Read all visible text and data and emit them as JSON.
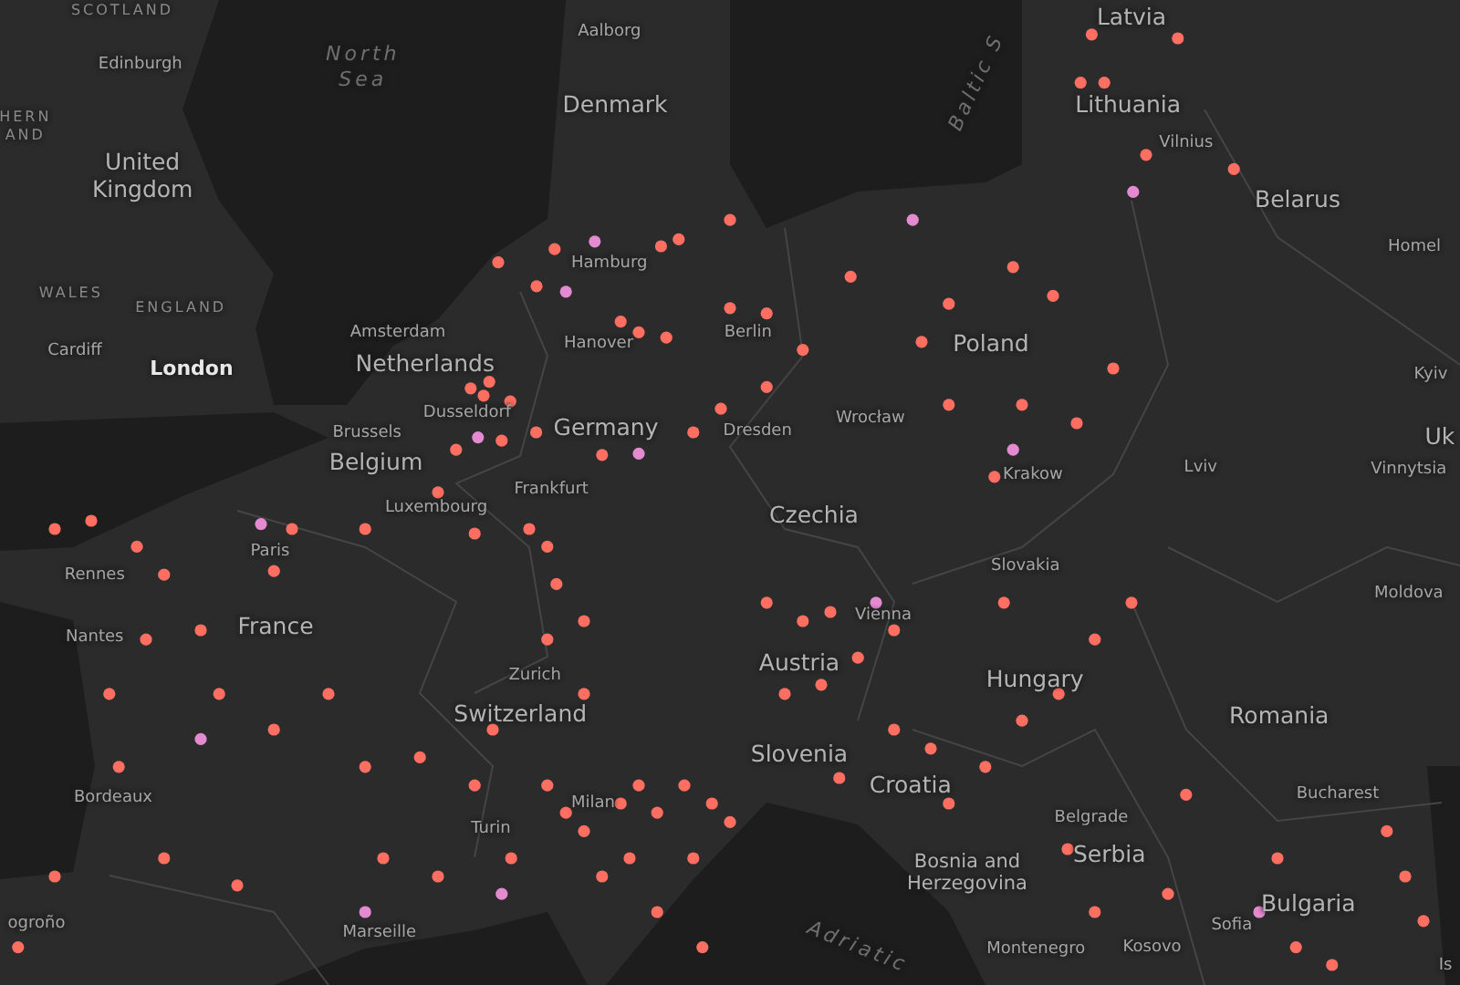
{
  "map": {
    "labels": [
      {
        "text": "SCOTLAND",
        "kind": "region"
      },
      {
        "text": "HERN AND",
        "kind": "region"
      },
      {
        "text": "Edinburgh",
        "kind": "city"
      },
      {
        "text": "United Kingdom",
        "kind": "country"
      },
      {
        "text": "WALES",
        "kind": "region"
      },
      {
        "text": "ENGLAND",
        "kind": "region"
      },
      {
        "text": "Cardiff",
        "kind": "city"
      },
      {
        "text": "London",
        "kind": "capital"
      },
      {
        "text": "North Sea",
        "kind": "sea"
      },
      {
        "text": "Aalborg",
        "kind": "city"
      },
      {
        "text": "Denmark",
        "kind": "country"
      },
      {
        "text": "Baltic S",
        "kind": "sea_up"
      },
      {
        "text": "Latvia",
        "kind": "country"
      },
      {
        "text": "Lithuania",
        "kind": "country"
      },
      {
        "text": "Vilnius",
        "kind": "city"
      },
      {
        "text": "Belarus",
        "kind": "country"
      },
      {
        "text": "Homel",
        "kind": "city"
      },
      {
        "text": "Hamburg",
        "kind": "city"
      },
      {
        "text": "Amsterdam",
        "kind": "city"
      },
      {
        "text": "Netherlands",
        "kind": "country"
      },
      {
        "text": "Hanover",
        "kind": "city"
      },
      {
        "text": "Berlin",
        "kind": "city"
      },
      {
        "text": "Poland",
        "kind": "country"
      },
      {
        "text": "Kyiv",
        "kind": "city"
      },
      {
        "text": "Brussels",
        "kind": "city"
      },
      {
        "text": "Dusseldorf",
        "kind": "city"
      },
      {
        "text": "Germany",
        "kind": "country"
      },
      {
        "text": "Dresden",
        "kind": "city"
      },
      {
        "text": "Wrocław",
        "kind": "city"
      },
      {
        "text": "Uk",
        "kind": "country"
      },
      {
        "text": "Belgium",
        "kind": "country"
      },
      {
        "text": "Krakow",
        "kind": "city"
      },
      {
        "text": "Lviv",
        "kind": "city"
      },
      {
        "text": "Vinnytsia",
        "kind": "city"
      },
      {
        "text": "Luxembourg",
        "kind": "city"
      },
      {
        "text": "Frankfurt",
        "kind": "city"
      },
      {
        "text": "Czechia",
        "kind": "country"
      },
      {
        "text": "Paris",
        "kind": "city"
      },
      {
        "text": "Rennes",
        "kind": "city"
      },
      {
        "text": "Slovakia",
        "kind": "city"
      },
      {
        "text": "Moldova",
        "kind": "city"
      },
      {
        "text": "Vienna",
        "kind": "city"
      },
      {
        "text": "Nantes",
        "kind": "city"
      },
      {
        "text": "France",
        "kind": "country"
      },
      {
        "text": "Austria",
        "kind": "country"
      },
      {
        "text": "Zurich",
        "kind": "city"
      },
      {
        "text": "Hungary",
        "kind": "country"
      },
      {
        "text": "Switzerland",
        "kind": "country"
      },
      {
        "text": "Romania",
        "kind": "country"
      },
      {
        "text": "Slovenia",
        "kind": "country"
      },
      {
        "text": "Croatia",
        "kind": "country"
      },
      {
        "text": "Bordeaux",
        "kind": "city"
      },
      {
        "text": "Bucharest",
        "kind": "city"
      },
      {
        "text": "Milan",
        "kind": "city"
      },
      {
        "text": "Belgrade",
        "kind": "city"
      },
      {
        "text": "Turin",
        "kind": "city"
      },
      {
        "text": "Serbia",
        "kind": "country"
      },
      {
        "text": "Bosnia and Herzegovina",
        "kind": "country_small"
      },
      {
        "text": "Bulgaria",
        "kind": "country"
      },
      {
        "text": "Sofia",
        "kind": "city"
      },
      {
        "text": "Marseille",
        "kind": "city"
      },
      {
        "text": "ogroño",
        "kind": "city"
      },
      {
        "text": "Montenegro",
        "kind": "city"
      },
      {
        "text": "Kosovo",
        "kind": "city"
      },
      {
        "text": "Adriatic",
        "kind": "sea_down"
      },
      {
        "text": "Is",
        "kind": "city"
      }
    ],
    "markers": [
      {
        "color": "#ff6f61"
      },
      {
        "color": "#ff6f61"
      },
      {
        "color": "#e48ad0"
      },
      {
        "color": "#ff6f61"
      },
      {
        "color": "#ff6f61"
      },
      {
        "color": "#ff6f61"
      },
      {
        "color": "#ff6f61"
      },
      {
        "color": "#e48ad0"
      },
      {
        "color": "#ff6f61"
      },
      {
        "color": "#ff6f61"
      },
      {
        "color": "#ff6f61"
      },
      {
        "color": "#ff6f61"
      },
      {
        "color": "#ff6f61"
      },
      {
        "color": "#ff6f61"
      },
      {
        "color": "#ff6f61"
      },
      {
        "color": "#ff6f61"
      },
      {
        "color": "#ff6f61"
      },
      {
        "color": "#e48ad0"
      },
      {
        "color": "#ff6f61"
      },
      {
        "color": "#ff6f61"
      },
      {
        "color": "#ff6f61"
      },
      {
        "color": "#ff6f61"
      },
      {
        "color": "#ff6f61"
      },
      {
        "color": "#e48ad0"
      },
      {
        "color": "#ff6f61"
      },
      {
        "color": "#ff6f61"
      },
      {
        "color": "#ff6f61"
      },
      {
        "color": "#ff6f61"
      },
      {
        "color": "#ff6f61"
      },
      {
        "color": "#ff6f61"
      },
      {
        "color": "#ff6f61"
      },
      {
        "color": "#ff6f61"
      },
      {
        "color": "#ff6f61"
      },
      {
        "color": "#e48ad0"
      },
      {
        "color": "#ff6f61"
      },
      {
        "color": "#ff6f61"
      },
      {
        "color": "#ff6f61"
      },
      {
        "color": "#ff6f61"
      },
      {
        "color": "#ff6f61"
      },
      {
        "color": "#ff6f61"
      },
      {
        "color": "#e48ad0"
      },
      {
        "color": "#ff6f61"
      },
      {
        "color": "#ff6f61"
      },
      {
        "color": "#ff6f61"
      },
      {
        "color": "#ff6f61"
      },
      {
        "color": "#ff6f61"
      },
      {
        "color": "#ff6f61"
      },
      {
        "color": "#e48ad0"
      },
      {
        "color": "#ff6f61"
      },
      {
        "color": "#ff6f61"
      },
      {
        "color": "#ff6f61"
      },
      {
        "color": "#ff6f61"
      },
      {
        "color": "#ff6f61"
      },
      {
        "color": "#ff6f61"
      },
      {
        "color": "#ff6f61"
      },
      {
        "color": "#e48ad0"
      },
      {
        "color": "#ff6f61"
      },
      {
        "color": "#ff6f61"
      },
      {
        "color": "#ff6f61"
      },
      {
        "color": "#ff6f61"
      },
      {
        "color": "#ff6f61"
      },
      {
        "color": "#ff6f61"
      },
      {
        "color": "#ff6f61"
      },
      {
        "color": "#ff6f61"
      },
      {
        "color": "#ff6f61"
      },
      {
        "color": "#ff6f61"
      },
      {
        "color": "#e48ad0"
      },
      {
        "color": "#ff6f61"
      },
      {
        "color": "#ff6f61"
      },
      {
        "color": "#ff6f61"
      },
      {
        "color": "#ff6f61"
      },
      {
        "color": "#ff6f61"
      },
      {
        "color": "#ff6f61"
      },
      {
        "color": "#ff6f61"
      },
      {
        "color": "#e48ad0"
      },
      {
        "color": "#ff6f61"
      },
      {
        "color": "#ff6f61"
      },
      {
        "color": "#ff6f61"
      },
      {
        "color": "#ff6f61"
      },
      {
        "color": "#ff6f61"
      },
      {
        "color": "#ff6f61"
      },
      {
        "color": "#ff6f61"
      },
      {
        "color": "#ff6f61"
      },
      {
        "color": "#ff6f61"
      },
      {
        "color": "#ff6f61"
      },
      {
        "color": "#ff6f61"
      },
      {
        "color": "#ff6f61"
      },
      {
        "color": "#ff6f61"
      },
      {
        "color": "#ff6f61"
      },
      {
        "color": "#ff6f61"
      },
      {
        "color": "#ff6f61"
      },
      {
        "color": "#ff6f61"
      },
      {
        "color": "#ff6f61"
      },
      {
        "color": "#ff6f61"
      },
      {
        "color": "#e48ad0"
      },
      {
        "color": "#ff6f61"
      },
      {
        "color": "#ff6f61"
      },
      {
        "color": "#ff6f61"
      },
      {
        "color": "#ff6f61"
      },
      {
        "color": "#ff6f61"
      },
      {
        "color": "#e48ad0"
      },
      {
        "color": "#ff6f61"
      },
      {
        "color": "#ff6f61"
      },
      {
        "color": "#ff6f61"
      },
      {
        "color": "#ff6f61"
      },
      {
        "color": "#ff6f61"
      },
      {
        "color": "#ff6f61"
      },
      {
        "color": "#ff6f61"
      },
      {
        "color": "#ff6f61"
      },
      {
        "color": "#ff6f61"
      },
      {
        "color": "#ff6f61"
      },
      {
        "color": "#ff6f61"
      },
      {
        "color": "#ff6f61"
      },
      {
        "color": "#ff6f61"
      },
      {
        "color": "#ff6f61"
      },
      {
        "color": "#ff6f61"
      },
      {
        "color": "#ff6f61"
      },
      {
        "color": "#ff6f61"
      },
      {
        "color": "#e48ad0"
      },
      {
        "color": "#ff6f61"
      },
      {
        "color": "#ff6f61"
      },
      {
        "color": "#ff6f61"
      },
      {
        "color": "#ff6f61"
      },
      {
        "color": "#ff6f61"
      },
      {
        "color": "#ff6f61"
      },
      {
        "color": "#ff6f61"
      }
    ]
  }
}
